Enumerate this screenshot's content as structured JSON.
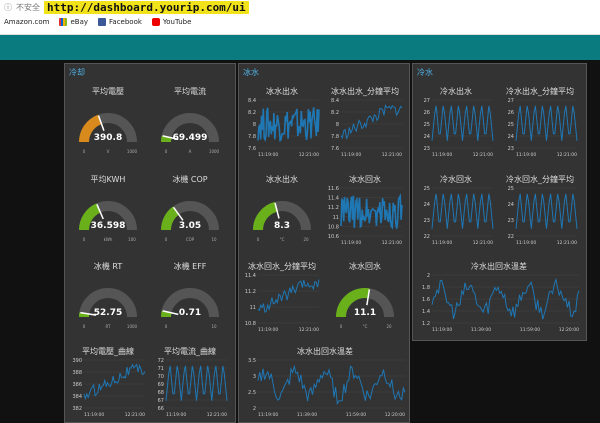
{
  "browser": {
    "security": "不安全",
    "url": "http://dashboard.yourip.com/ui",
    "bookmarks": [
      {
        "label": "Amazon.com"
      },
      {
        "label": "eBay"
      },
      {
        "label": "Facebook"
      },
      {
        "label": "YouTube"
      }
    ]
  },
  "groups": {
    "g1": "冷却",
    "g2": "冰水",
    "g3": "冷水"
  },
  "colors": {
    "accent": "#0a7b7f",
    "line": "#1f77b4",
    "gauge_green": "#6ab01a",
    "gauge_orange": "#d88a1c"
  },
  "gauges": [
    {
      "title": "平均電壓",
      "value": "390.8",
      "min": "0",
      "unit": "V",
      "max": "1000",
      "fraction": 0.39
    },
    {
      "title": "平均電流",
      "value": "69.499",
      "min": "0",
      "unit": "A",
      "max": "1000",
      "fraction": 0.07
    },
    {
      "title": "平均KWH",
      "value": "36.598",
      "min": "0",
      "unit": "kWh",
      "max": "100",
      "fraction": 0.37
    },
    {
      "title": "冰機 COP",
      "value": "3.05",
      "min": "0",
      "unit": "COP",
      "max": "10",
      "fraction": 0.3
    },
    {
      "title": "冰機 RT",
      "value": "52.75",
      "min": "0",
      "unit": "RT",
      "max": "1000",
      "fraction": 0.05
    },
    {
      "title": "冰機 EFF",
      "value": "0.71",
      "min": "0",
      "unit": "",
      "max": "10",
      "fraction": 0.07
    },
    {
      "title": "冰水出水",
      "value": "8.3",
      "min": "0",
      "unit": "°C",
      "max": "20",
      "fraction": 0.42
    },
    {
      "title": "冰水回水",
      "value": "11.1",
      "min": "0",
      "unit": "°C",
      "max": "20",
      "fraction": 0.55
    }
  ],
  "charts": {
    "c1": {
      "title": "冰水出水",
      "yticks": [
        "8.4",
        "8.2",
        "8",
        "7.8",
        "7.6"
      ],
      "xticks": [
        "11:19:00",
        "12:21:00"
      ],
      "ylim": [
        7.6,
        8.4
      ]
    },
    "c2": {
      "title": "冰水出水_分鐘平均",
      "yticks": [
        "8.4",
        "8.2",
        "8",
        "7.8",
        "7.6"
      ],
      "xticks": [
        "11:19:00",
        "12:21:00"
      ],
      "ylim": [
        7.6,
        8.4
      ]
    },
    "c3": {
      "title": "冷水出水",
      "yticks": [
        "27",
        "26",
        "25",
        "24",
        "23"
      ],
      "xticks": [
        "11:19:00",
        "12:21:00"
      ],
      "ylim": [
        23,
        27
      ]
    },
    "c4": {
      "title": "冷水出水_分鐘平均",
      "yticks": [
        "27",
        "26",
        "25",
        "24",
        "23"
      ],
      "xticks": [
        "11:19:00",
        "12:21:00"
      ],
      "ylim": [
        23,
        27
      ]
    },
    "c5": {
      "title": "冰水回水",
      "yticks": [
        "11.6",
        "11.4",
        "11.2",
        "11",
        "10.8",
        "10.6"
      ],
      "xticks": [
        "11:19:00",
        "12:21:00"
      ],
      "ylim": [
        10.6,
        11.6
      ]
    },
    "c6": {
      "title": "冷水回水",
      "yticks": [
        "25",
        "24",
        "23",
        "22"
      ],
      "xticks": [
        "11:19:00",
        "12:21:00"
      ],
      "ylim": [
        22,
        25
      ]
    },
    "c7": {
      "title": "冷水回水_分鐘平均",
      "yticks": [
        "25",
        "24",
        "23",
        "22"
      ],
      "xticks": [
        "11:19:00",
        "12:21:00"
      ],
      "ylim": [
        22,
        25
      ]
    },
    "c8": {
      "title": "冰水回水_分鐘平均",
      "yticks": [
        "11.4",
        "11.2",
        "11",
        "10.8"
      ],
      "xticks": [
        "11:19:00",
        "12:21:00"
      ],
      "ylim": [
        10.8,
        11.4
      ]
    },
    "c9": {
      "title": "冷水出回水溫差",
      "yticks": [
        "2",
        "1.8",
        "1.6",
        "1.4",
        "1.2"
      ],
      "xticks": [
        "11:19:00",
        "11:39:00",
        "11:59:00",
        "12:20:00"
      ],
      "ylim": [
        1.2,
        2
      ]
    },
    "c10": {
      "title": "平均電壓_曲線",
      "yticks": [
        "390",
        "388",
        "386",
        "384",
        "382"
      ],
      "xticks": [
        "11:19:00",
        "12:21:00"
      ],
      "ylim": [
        382,
        390
      ]
    },
    "c11": {
      "title": "平均電流_曲線",
      "yticks": [
        "72",
        "71",
        "70",
        "69",
        "68",
        "67",
        "66"
      ],
      "xticks": [
        "11:19:00",
        "12:21:00"
      ],
      "ylim": [
        66,
        72
      ]
    },
    "c12": {
      "title": "冰水出回水溫差",
      "yticks": [
        "3.5",
        "3",
        "2.5",
        "2"
      ],
      "xticks": [
        "11:19:00",
        "11:39:00",
        "11:59:00",
        "12:20:00"
      ],
      "ylim": [
        2,
        3.5
      ]
    }
  }
}
